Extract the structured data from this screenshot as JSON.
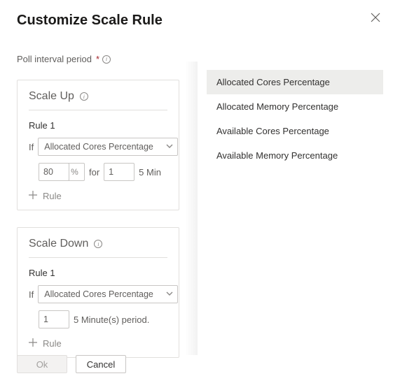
{
  "title": "Customize Scale Rule",
  "poll_label": "Poll interval period",
  "required_marker": "*",
  "scale_up": {
    "header": "Scale Up",
    "rule_label": "Rule 1",
    "if_label": "If",
    "metric": "Allocated Cores Percentage",
    "threshold": "80",
    "unit": "%",
    "for_label": "for",
    "duration": "1",
    "period_suffix": "5 Min",
    "add_rule_label": "Rule"
  },
  "scale_down": {
    "header": "Scale Down",
    "rule_label": "Rule 1",
    "if_label": "If",
    "metric": "Allocated Cores Percentage",
    "duration": "1",
    "period_suffix": "5 Minute(s) period.",
    "add_rule_label": "Rule"
  },
  "footer": {
    "ok": "Ok",
    "cancel": "Cancel"
  },
  "dropdown": {
    "options": [
      "Allocated Cores Percentage",
      "Allocated Memory Percentage",
      "Available Cores Percentage",
      "Available Memory Percentage"
    ],
    "selected_index": 0
  }
}
